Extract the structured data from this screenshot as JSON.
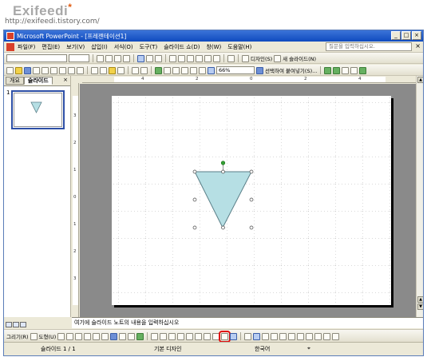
{
  "watermark": {
    "logo": "Exifeedi",
    "star": "*",
    "url": "http://exifeedi.tistory.com/"
  },
  "window": {
    "title": "Microsoft PowerPoint - [프레젠테이션1]",
    "btn_min": "_",
    "btn_max": "□",
    "btn_close": "×"
  },
  "menu": {
    "items": [
      "파일(F)",
      "편집(E)",
      "보기(V)",
      "삽입(I)",
      "서식(O)",
      "도구(T)",
      "슬라이드 쇼(D)",
      "창(W)",
      "도움말(H)"
    ],
    "help_placeholder": "질문을 입력하십시오.",
    "close": "×"
  },
  "toolbar_std": {
    "zoom": "66%",
    "pane_cmd": "선택하여 붙여넣기(S)..."
  },
  "toolbar_fmt": {
    "design": "디자인(S)",
    "new_slide": "새 슬라이드(N)"
  },
  "pane": {
    "tabs": [
      "개요",
      "슬라이드"
    ],
    "close": "×",
    "slide_number": "1"
  },
  "ruler": {
    "h_ticks": [
      "4",
      "2",
      "0",
      "2",
      "4"
    ],
    "v_ticks": [
      "3",
      "2",
      "1",
      "0",
      "1",
      "2",
      "3"
    ]
  },
  "notes": {
    "text": "여기에 슬라이드 노트의 내용을 입력하십시오"
  },
  "drawbar": {
    "draw_label": "그리기(R)",
    "autoshape_label": "도형(U)"
  },
  "status": {
    "slide": "슬라이드 1 / 1",
    "design": "기본 디자인",
    "language": "한국어"
  },
  "slide": {
    "shape": "inverted-triangle",
    "fill_color": "#b6dfe4",
    "stroke_color": "#5a7f88",
    "handle_rotate_color": "#33a033"
  }
}
